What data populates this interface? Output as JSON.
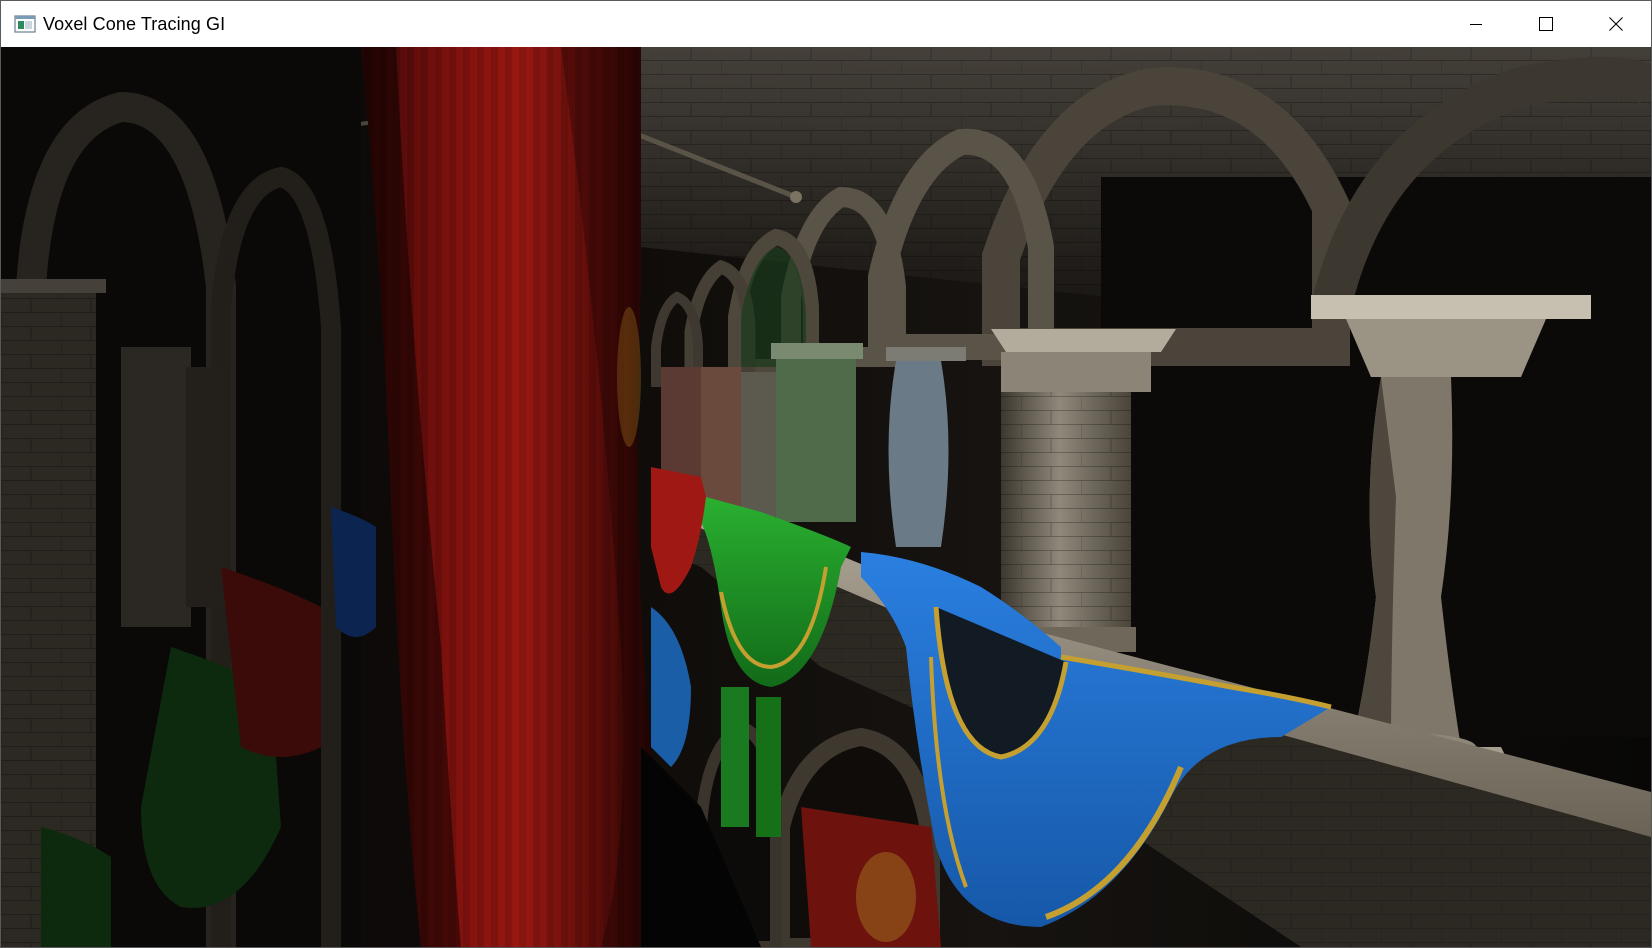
{
  "window": {
    "title": "Voxel Cone Tracing GI",
    "app_icon": "window-app-icon",
    "controls": [
      {
        "name": "minimize-button",
        "icon": "minimize-icon"
      },
      {
        "name": "maximize-button",
        "icon": "maximize-icon"
      },
      {
        "name": "close-button",
        "icon": "close-icon"
      }
    ]
  },
  "viewport": {
    "scene": "rendered-3d-atrium-scene",
    "colors": {
      "red_curtain": "#8e1410",
      "blue_drape": "#1c6fd0",
      "green_drape": "#1f9a26",
      "stone": "#8a8275",
      "shadow": "#0a0807"
    }
  }
}
